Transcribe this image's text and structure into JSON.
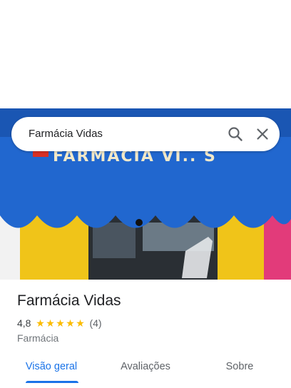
{
  "search": {
    "query": "Farmácia Vidas"
  },
  "hero": {
    "awning_sign_text": "FARMACIA VI.. S"
  },
  "place": {
    "name": "Farmácia Vidas",
    "rating": "4,8",
    "stars": "★★★★★",
    "review_count": "(4)",
    "category": "Farmácia"
  },
  "tabs": [
    {
      "label": "Visão geral",
      "active": true
    },
    {
      "label": "Avaliações",
      "active": false
    },
    {
      "label": "Sobre",
      "active": false
    }
  ],
  "colors": {
    "accent": "#1a73e8",
    "star": "#fbbc04",
    "awning": "#1f62c8"
  }
}
